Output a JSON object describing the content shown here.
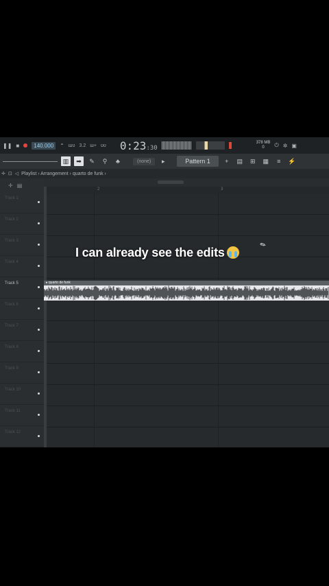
{
  "transport": {
    "tempo": "140.000",
    "pattern_num": "3.2",
    "time": "0:23",
    "time_cs": ":30",
    "memory_line1": "378 MB",
    "memory_line2": "0"
  },
  "toolbar": {
    "none_label": "(none)",
    "pattern_label": "Pattern 1"
  },
  "breadcrumb": {
    "path": "Playlist › Arrangement › quarto de funk ›"
  },
  "ruler": {
    "marks": [
      "2",
      "3",
      "5"
    ]
  },
  "tracks": [
    {
      "name": "Track 1"
    },
    {
      "name": "Track 2"
    },
    {
      "name": "Track 3"
    },
    {
      "name": "Track 4"
    },
    {
      "name": "Track 5"
    },
    {
      "name": "Track 6"
    },
    {
      "name": "Track 7"
    },
    {
      "name": "Track 8"
    },
    {
      "name": "Track 9"
    },
    {
      "name": "Track 10"
    },
    {
      "name": "Track 11"
    },
    {
      "name": "Track 12"
    }
  ],
  "clip": {
    "title": "▸ quarto de funk"
  },
  "overlay": {
    "caption": "I can already see the edits",
    "emoji_icon": "loudly-crying-face-icon"
  },
  "colors": {
    "accent_record": "#e0463f",
    "tempo_text": "#9fd0ef",
    "clip_bg": "#e6e8ea"
  }
}
